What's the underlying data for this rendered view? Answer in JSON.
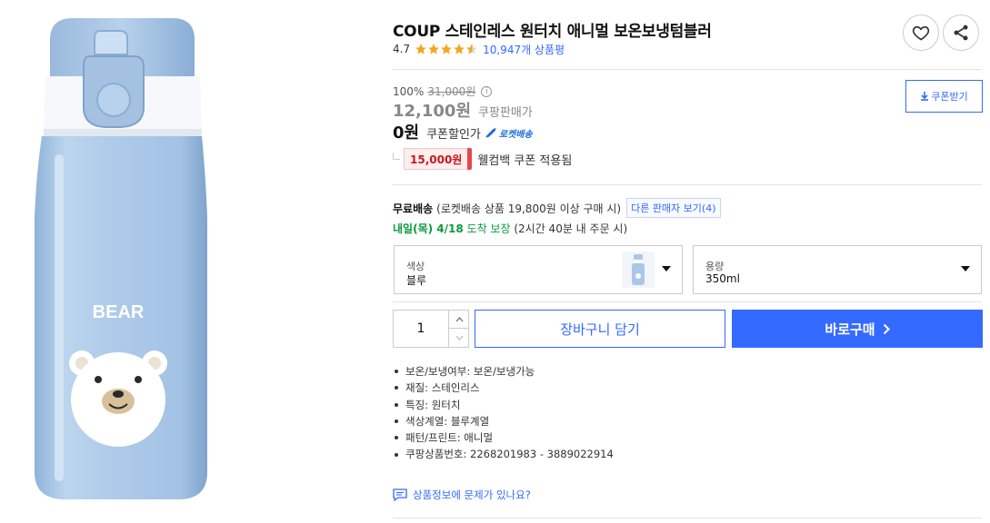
{
  "product": {
    "title": "COUP 스테인레스 원터치 애니멀 보온보냉텀블러",
    "rating_value": "4.7",
    "rating_score": 4.7,
    "review_count": "10,947개 상품평",
    "image_label": "BEAR"
  },
  "price": {
    "discount_rate": "100%",
    "original_price": "31,000원",
    "sale_price": "12,100원",
    "sale_label": "쿠팡판매가",
    "coupon_price": "0원",
    "coupon_label": "쿠폰할인가",
    "rocket_badge": "로켓배송",
    "welcome_coupon_amount": "15,000원",
    "welcome_coupon_text": "웰컴백 쿠폰 적용됨",
    "coupon_download_label": "쿠폰받기"
  },
  "shipping": {
    "free_label": "무료배송",
    "free_condition": "(로켓배송 상품 19,800원 이상 구매 시)",
    "other_sellers_label": "다른 판매자 보기(4)",
    "arrival_day": "내일(목) 4/18",
    "arrival_guarantee": "도착 보장",
    "arrival_condition": "(2시간 40분 내 주문 시)"
  },
  "options": {
    "color_label": "색상",
    "color_value": "블루",
    "size_label": "용량",
    "size_value": "350ml"
  },
  "purchase": {
    "quantity": "1",
    "cart_label": "장바구니 담기",
    "buy_label": "바로구매"
  },
  "attributes": [
    "보온/보냉여부: 보온/보냉가능",
    "재질: 스테인리스",
    "특징: 원터치",
    "색상계열: 블루계열",
    "패턴/프린트: 애니멀",
    "쿠팡상품번호: 2268201983 - 3889022914"
  ],
  "report_label": "상품정보에 문제가 있나요?",
  "icons": {
    "heart": "heart-icon",
    "share": "share-icon",
    "info": "info-icon",
    "download": "download-icon",
    "rocket": "rocket-icon",
    "chevron_right": "chevron-right-icon",
    "caret_down": "caret-down-icon",
    "chat": "chat-icon"
  },
  "colors": {
    "accent": "#346aff",
    "rating_star": "#f5a623",
    "coupon_red": "#c8171e",
    "arrival_green": "#0b9a3d",
    "bottle_blue": "#a9c7e8"
  }
}
